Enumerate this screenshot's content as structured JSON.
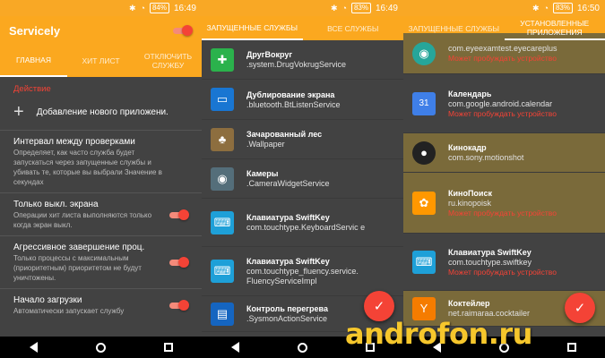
{
  "status": [
    {
      "battery": "84%",
      "time": "16:49"
    },
    {
      "battery": "83%",
      "time": "16:49"
    },
    {
      "battery": "83%",
      "time": "16:50"
    }
  ],
  "screen1": {
    "title": "Servicely",
    "tabs": [
      "ГЛАВНАЯ",
      "ХИТ ЛИСТ",
      "ОТКЛЮЧИТЬ СЛУЖБУ"
    ],
    "section": "Действие",
    "add_label": "Добавление нового приложени.",
    "rows": [
      {
        "title": "Интервал между проверками",
        "desc": "Определяет, как часто служба будет запускаться через запущенные службы и убивать те, которые вы выбрали Значение в секундах"
      },
      {
        "title": "Только выкл. экрана",
        "desc": "Операции хит листа  выполняются только когда экран выкл."
      },
      {
        "title": "Агрессивное завершение проц.",
        "desc": "Только процессы с максимальным (приоритетным) приоритетом не будут уничтожены."
      },
      {
        "title": "Начало загрузки",
        "desc": "Автоматически запускает службу"
      }
    ]
  },
  "screen2": {
    "tabs": [
      "ЗАПУЩЕННЫЕ СЛУЖБЫ",
      "ВСЕ СЛУЖБЫ"
    ],
    "items": [
      {
        "title": "ДругВокруг",
        "sub": ".system.DrugVokrugService",
        "icon": "plus-icon",
        "color": "#2BB24C"
      },
      {
        "title": "Дублирование экрана",
        "sub": ".bluetooth.BtListenService",
        "icon": "monitor-icon",
        "color": "#1976D2"
      },
      {
        "title": "Зачарованный лес",
        "sub": ".Wallpaper",
        "icon": "forest-icon",
        "color": "#8D6E3F"
      },
      {
        "title": "Камеры",
        "sub": ".CameraWidgetService",
        "icon": "camera-icon",
        "color": "#546E7A"
      },
      {
        "title": "Клавиатура SwiftKey",
        "sub": "com.touchtype.KeyboardServic e",
        "icon": "swiftkey-icon",
        "color": "#1EA0D8"
      },
      {
        "title": "Клавиатура SwiftKey",
        "sub": "com.touchtype_fluency.service. FluencyServiceImpl",
        "icon": "swiftkey-icon",
        "color": "#1EA0D8"
      },
      {
        "title": "Контроль перегрева",
        "sub": ".SysmonActionService",
        "icon": "thermo-icon",
        "color": "#1565C0"
      }
    ]
  },
  "screen3": {
    "tabs": [
      "ЗАПУЩЕННЫЕ СЛУЖБЫ",
      "УСТАНОВЛЕННЫЕ ПРИЛОЖЕНИЯ"
    ],
    "warn": "Может пробуждать устройство",
    "items": [
      {
        "title": "",
        "sub": "com.eyeexamtest.eyecareplus",
        "icon": "eye-icon",
        "color": "#26A69A",
        "hl": true
      },
      {
        "title": "Календарь",
        "sub": "com.google.android.calendar",
        "icon": "calendar-icon",
        "color": "#3F7FE8",
        "hl": false
      },
      {
        "title": "Кинокадр",
        "sub": "com.sony.motionshot",
        "icon": "film-icon",
        "color": "#222",
        "hl": true
      },
      {
        "title": "КиноПоиск",
        "sub": "ru.kinopoisk",
        "icon": "reel-icon",
        "color": "#FF9800",
        "hl": true
      },
      {
        "title": "Клавиатура SwiftKey",
        "sub": "com.touchtype.swiftkey",
        "icon": "swiftkey-icon",
        "color": "#1EA0D8",
        "hl": false
      },
      {
        "title": "Коктейлер",
        "sub": "net.raimaraa.cocktailer",
        "icon": "cocktail-icon",
        "color": "#F57C00",
        "hl": true
      }
    ]
  },
  "watermark": "androfon.ru"
}
